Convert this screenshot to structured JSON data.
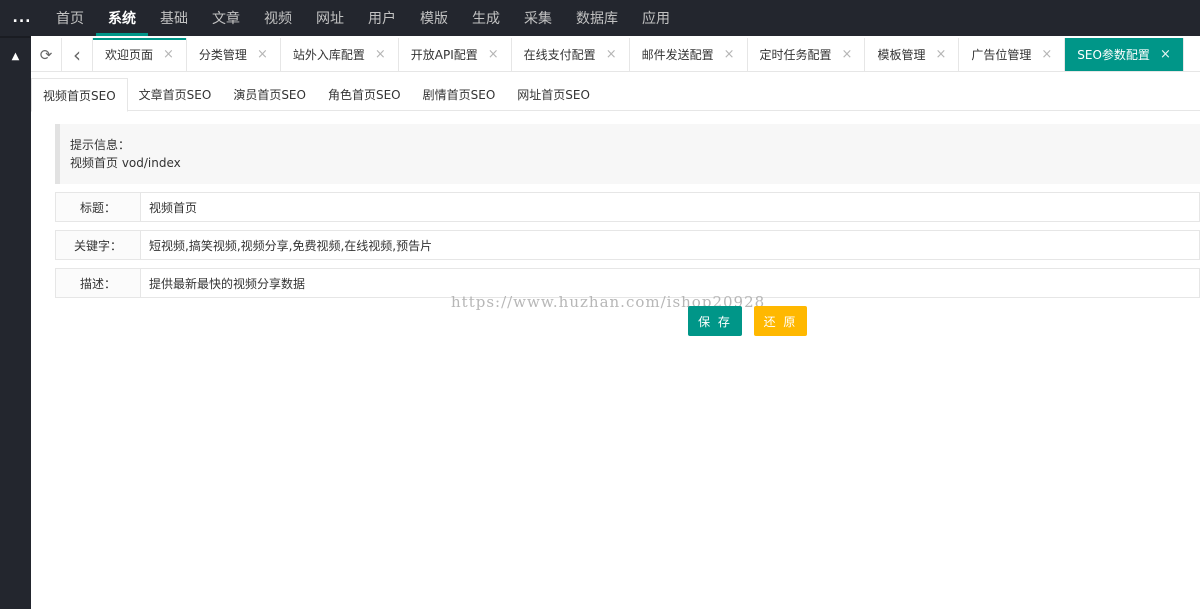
{
  "topnav": {
    "more_icon": "...",
    "items": [
      {
        "label": "首页"
      },
      {
        "label": "系统"
      },
      {
        "label": "基础"
      },
      {
        "label": "文章"
      },
      {
        "label": "视频"
      },
      {
        "label": "网址"
      },
      {
        "label": "用户"
      },
      {
        "label": "模版"
      },
      {
        "label": "生成"
      },
      {
        "label": "采集"
      },
      {
        "label": "数据库"
      },
      {
        "label": "应用"
      }
    ],
    "active_index": 1
  },
  "sidebar": {
    "toggle_icon": "▲"
  },
  "tabbar": {
    "refresh_icon": "⟳",
    "back_icon": "‹",
    "close_icon": "×",
    "tabs": [
      {
        "label": "欢迎页面"
      },
      {
        "label": "分类管理"
      },
      {
        "label": "站外入库配置"
      },
      {
        "label": "开放API配置"
      },
      {
        "label": "在线支付配置"
      },
      {
        "label": "邮件发送配置"
      },
      {
        "label": "定时任务配置"
      },
      {
        "label": "模板管理"
      },
      {
        "label": "广告位管理"
      },
      {
        "label": "SEO参数配置"
      }
    ]
  },
  "subtabs": [
    {
      "label": "视频首页SEO"
    },
    {
      "label": "文章首页SEO"
    },
    {
      "label": "演员首页SEO"
    },
    {
      "label": "角色首页SEO"
    },
    {
      "label": "剧情首页SEO"
    },
    {
      "label": "网址首页SEO"
    }
  ],
  "tip": {
    "heading": "提示信息：",
    "text": "视频首页 vod/index"
  },
  "form": {
    "title_label": "标题：",
    "title_value": "视频首页",
    "keywords_label": "关键字：",
    "keywords_value": "短视频,搞笑视频,视频分享,免费视频,在线视频,预告片",
    "desc_label": "描述：",
    "desc_value": "提供最新最快的视频分享数据"
  },
  "buttons": {
    "save": "保 存",
    "reset": "还 原"
  },
  "watermark": "https://www.huzhan.com/ishop20928",
  "colors": {
    "accent": "#009688",
    "warning": "#ffb800",
    "nav_bg": "#23262e"
  }
}
